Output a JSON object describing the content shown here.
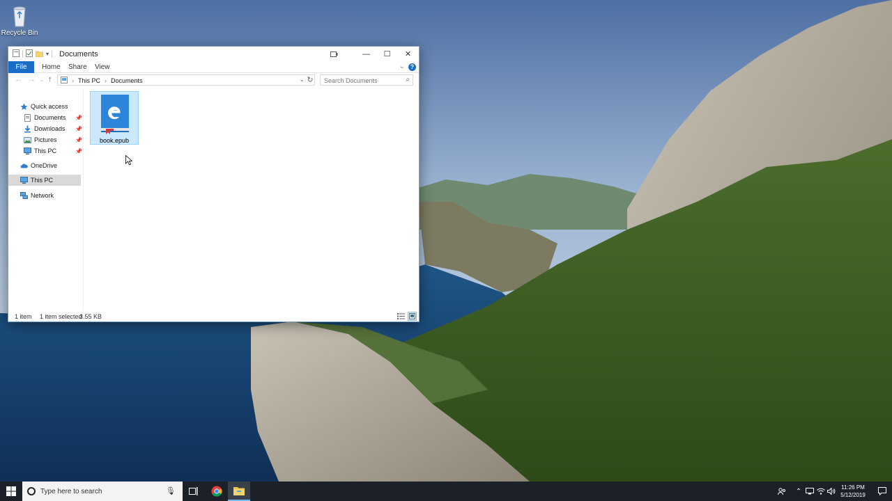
{
  "desktop": {
    "icons": [
      {
        "label": "Recycle Bin",
        "icon": "recycle-bin-icon"
      }
    ]
  },
  "window": {
    "title": "Documents",
    "controls": {
      "minimize": "—",
      "maximize": "☐",
      "close": "✕"
    },
    "ribbon": {
      "tabs": [
        "File",
        "Home",
        "Share",
        "View"
      ],
      "help": "?"
    },
    "address": {
      "crumbs": [
        "This PC",
        "Documents"
      ],
      "separator": "›"
    },
    "search": {
      "placeholder": "Search Documents"
    },
    "nav": {
      "items": [
        {
          "label": "Quick access",
          "icon": "star-icon"
        },
        {
          "label": "Documents",
          "icon": "documents-icon",
          "pinned": true
        },
        {
          "label": "Downloads",
          "icon": "download-icon",
          "pinned": true
        },
        {
          "label": "Pictures",
          "icon": "pictures-icon",
          "pinned": true
        },
        {
          "label": "This PC",
          "icon": "computer-icon",
          "pinned": true
        },
        {
          "label": "OneDrive",
          "icon": "cloud-icon"
        },
        {
          "label": "This PC",
          "icon": "computer-icon",
          "selected": true
        },
        {
          "label": "Network",
          "icon": "network-icon"
        }
      ]
    },
    "files": [
      {
        "name": "book.epub",
        "icon": "epub-edge-icon",
        "selected": true
      }
    ],
    "status": {
      "count": "1 item",
      "selected": "1 item selected",
      "size": "3.55 KB"
    }
  },
  "taskbar": {
    "search_placeholder": "Type here to search",
    "apps": [
      "task-view-icon",
      "chrome-icon",
      "file-explorer-icon"
    ],
    "active_app": "file-explorer-icon",
    "clock": {
      "time": "11:26 PM",
      "date": "5/12/2019"
    }
  },
  "colors": {
    "accent": "#1a6dc5",
    "selection_bg": "#cce8ff",
    "taskbar_bg": "#1c2129"
  }
}
